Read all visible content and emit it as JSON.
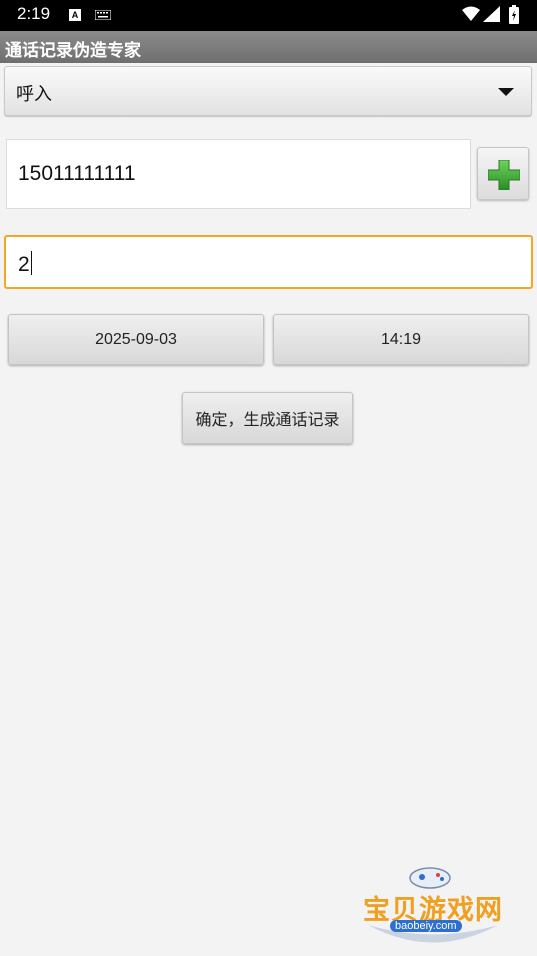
{
  "status_bar": {
    "time": "2:19",
    "notification_letter": "A"
  },
  "app": {
    "title": "通话记录伪造专家"
  },
  "call_type": {
    "selected": "呼入",
    "icon": "dropdown-arrow-icon"
  },
  "phone": {
    "value": "15011111111"
  },
  "add_contact": {
    "icon": "green-plus-icon",
    "color": "#3aa335"
  },
  "count": {
    "value": "2",
    "focus_color": "#f5a623"
  },
  "date_button": {
    "label": "2025-09-03"
  },
  "time_button": {
    "label": "14:19"
  },
  "confirm_button": {
    "label": "确定，生成通话记录"
  },
  "watermark": {
    "text": "宝贝游戏网",
    "url": "baobeiy.com"
  }
}
